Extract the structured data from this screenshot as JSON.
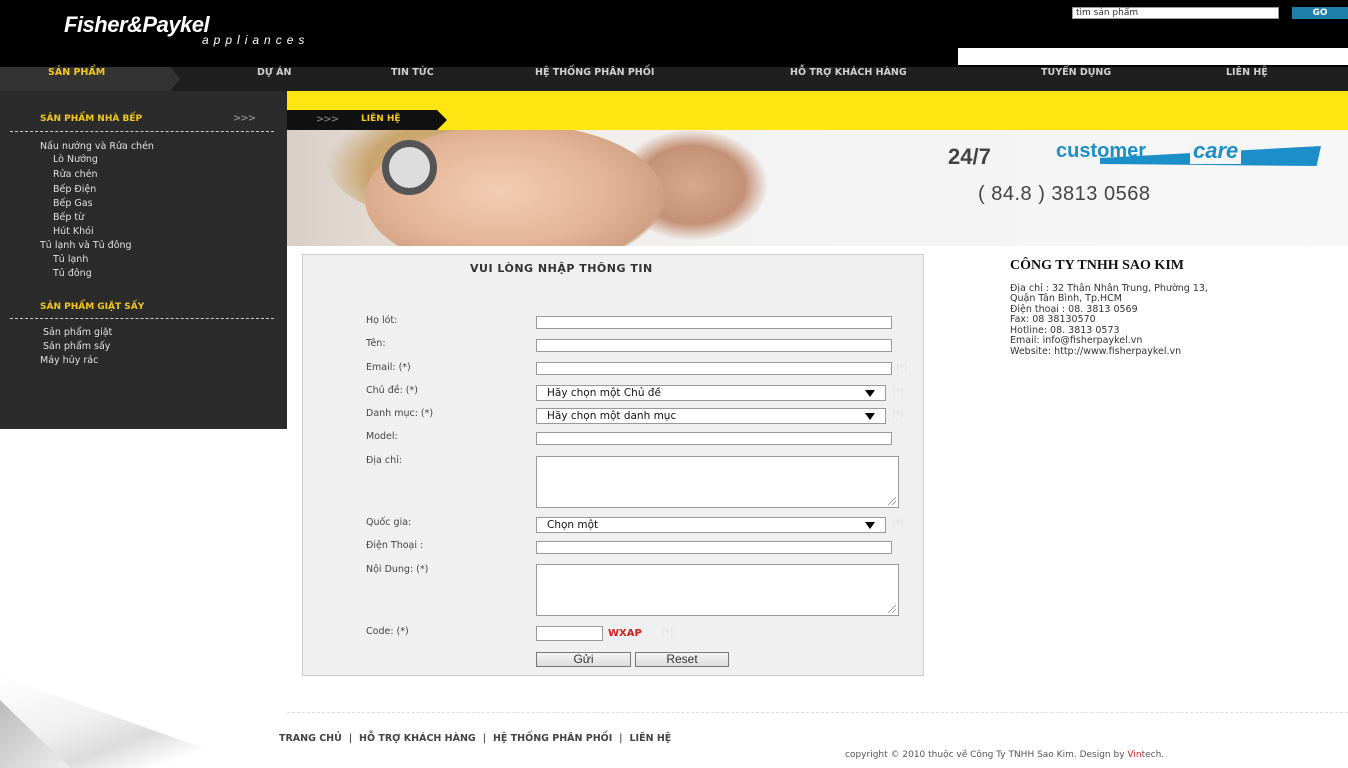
{
  "header": {
    "logo_main": "Fisher&Paykel",
    "logo_sub": "appliances",
    "search_value": "tìm sản phẩm",
    "go_label": "GO"
  },
  "nav": {
    "items": [
      "SẢN PHẨM",
      "DỰ ÁN",
      "TIN TỨC",
      "HỆ THỐNG PHÂN PHỐI",
      "HỖ TRỢ KHÁCH HÀNG",
      "TUYỂN DỤNG",
      "LIÊN HỆ"
    ]
  },
  "sidebar": {
    "kitchen_heading": "SẢN PHẨM NHÀ BẾP",
    "kitchen_arrows": ">>>",
    "kitchen_items": [
      "Nấu nướng và Rửa chén",
      "Lò Nướng",
      "Rửa chén",
      "Bếp Điện",
      "Bếp Gas",
      "Bếp từ",
      "Hút Khói",
      "Tủ lạnh và Tủ đông",
      "Tủ lạnh",
      "Tủ đông"
    ],
    "laundry_heading": "SẢN PHẨM GIẶT SẤY",
    "laundry_items": [
      "Sản phẩm giặt",
      "Sản phẩm sấy",
      "Máy hủy rác"
    ]
  },
  "breadcrumb": {
    "arrows": ">>>",
    "label": "LIÊN HỆ"
  },
  "banner": {
    "hours": "24/7",
    "care_a": "customer",
    "care_b": "care",
    "phone": "( 84.8 ) 3813 0568"
  },
  "form": {
    "title": "VUI LÒNG NHẬP THÔNG TIN",
    "labels": {
      "ho_lot": "Họ lót:",
      "ten": "Tên:",
      "email": "Email: (*)",
      "chu_de": "Chủ đề: (*)",
      "danh_muc": "Danh mục: (*)",
      "model": "Model:",
      "dia_chi": "Địa chỉ:",
      "quoc_gia": "Quốc gia:",
      "dien_thoai": "Điện Thoại :",
      "noi_dung": "Nội Dung: (*)",
      "code": "Code: (*)"
    },
    "required_mark": "(*)",
    "selects": {
      "chu_de": "Hãy chọn một Chủ đề",
      "danh_muc": "Hãy chọn một danh mục",
      "quoc_gia": "Chọn một"
    },
    "captcha": "WXAP",
    "submit_label": "Gửi",
    "reset_label": "Reset"
  },
  "company": {
    "name": "CÔNG TY TNHH SAO KIM",
    "address_1": "Địa chỉ : 32 Thân Nhân Trung, Phường 13,",
    "address_2": "Quận Tân Bình, Tp.HCM",
    "phone": "Điện thoại : 08. 3813 0569",
    "fax": "Fax: 08 38130570",
    "hotline": "Hotline: 08. 3813 0573",
    "email": "Email: info@fisherpaykel.vn",
    "website": "Website: http://www.fisherpaykel.vn"
  },
  "footer": {
    "links": [
      "TRANG CHỦ",
      "HỖ TRỢ KHÁCH HÀNG",
      "HỆ THỐNG PHÂN PHỐI",
      "LIÊN HỆ"
    ],
    "separator": "|",
    "copyright_prefix": "copyright © 2010 thuộc về Công Ty TNHH Sao Kim. Design by ",
    "brand_a": "Vin",
    "brand_b": "tech",
    "copyright_suffix": "."
  }
}
